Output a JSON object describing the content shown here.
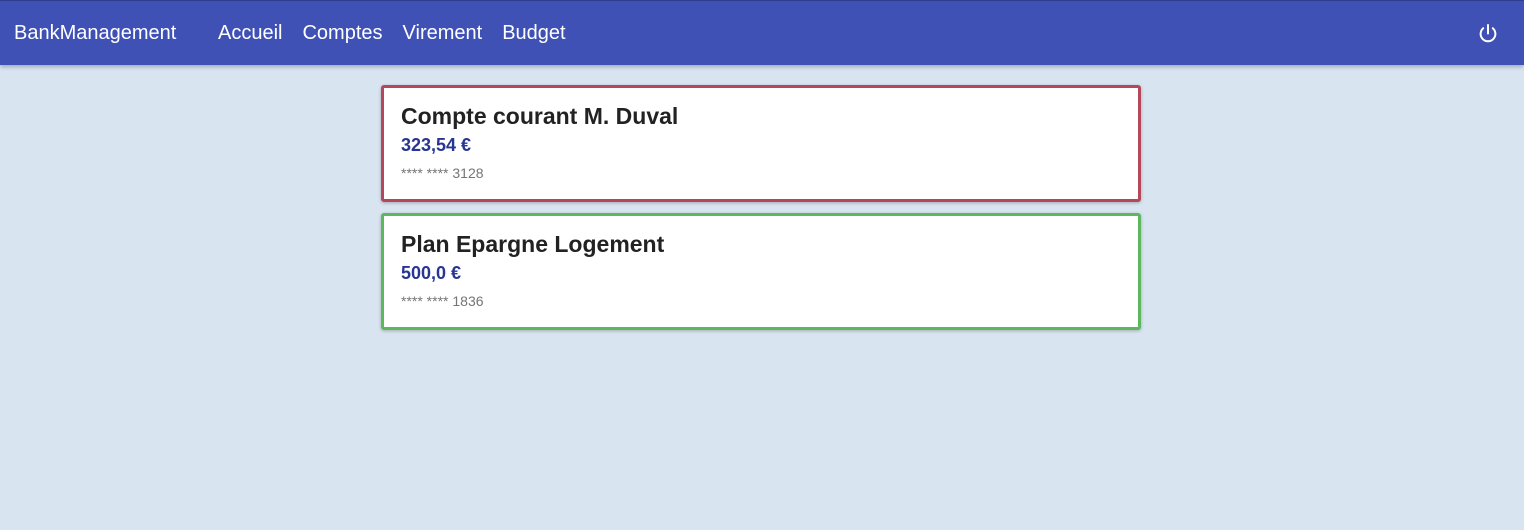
{
  "header": {
    "brand": "BankManagement",
    "nav": [
      {
        "label": "Accueil"
      },
      {
        "label": "Comptes"
      },
      {
        "label": "Virement"
      },
      {
        "label": "Budget"
      }
    ],
    "power_icon": "power-icon"
  },
  "colors": {
    "header_bg": "#3f51b5",
    "page_bg": "#d8e4f0",
    "balance_text": "#283593",
    "card_negative_border": "#b5475a",
    "card_positive_border": "#5cb85c"
  },
  "accounts": [
    {
      "name": "Compte courant M. Duval",
      "balance": "323,54 €",
      "number": "**** **** 3128",
      "border_color": "#b5475a"
    },
    {
      "name": "Plan Epargne Logement",
      "balance": "500,0 €",
      "number": "**** **** 1836",
      "border_color": "#5cb85c"
    }
  ]
}
